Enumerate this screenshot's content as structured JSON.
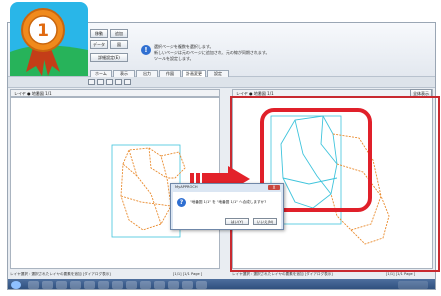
{
  "ribbon": {
    "buttons": [
      "移動",
      "追加",
      "データ",
      "図",
      "詳細設定(E)"
    ],
    "info_lines": [
      "選択ページを複数を選択します。",
      "新しいページは元のページに追加され、元の線が同期されます。",
      "ツールを設定します。"
    ],
    "tabs": [
      "ホーム",
      "表示",
      "出力",
      "作図",
      "計画変更",
      "設定"
    ],
    "active_tab": "計画変更"
  },
  "left_pane": {
    "header": "レイヤ ● 地番図 1/1"
  },
  "right_pane": {
    "header": "レイヤ ● 地番図 1/1",
    "button": "全体表示"
  },
  "status": {
    "left": "レイヤ選択 : 選択されたレイヤの要素を追加 [ダイアログ表示]",
    "left_page": "[1/1] [1/1 Page ]",
    "right": "レイヤ選択 : 選択されたレイヤの要素を追加 [ダイアログ表示]",
    "right_page": "[1/1] [1/1 Page ]"
  },
  "dialog": {
    "title": "MyAPPROCH",
    "close": "X",
    "message": "\"地番図 1/1\" を \"地番図 1/1\" へ合成しますか?",
    "yes": "はい(Y)",
    "no": "いいえ(N)"
  },
  "badge": {
    "number": "1",
    "colors": {
      "sky": "#29b6e8",
      "grass": "#27b35a",
      "medal": "#f08a1c",
      "ribbon": "#c43d18"
    }
  },
  "colors": {
    "highlight": "#e0202a",
    "arrow": "#e3222a",
    "cyan_parcel": "#3fc4dc",
    "orange_parcel": "#e98a2c"
  }
}
